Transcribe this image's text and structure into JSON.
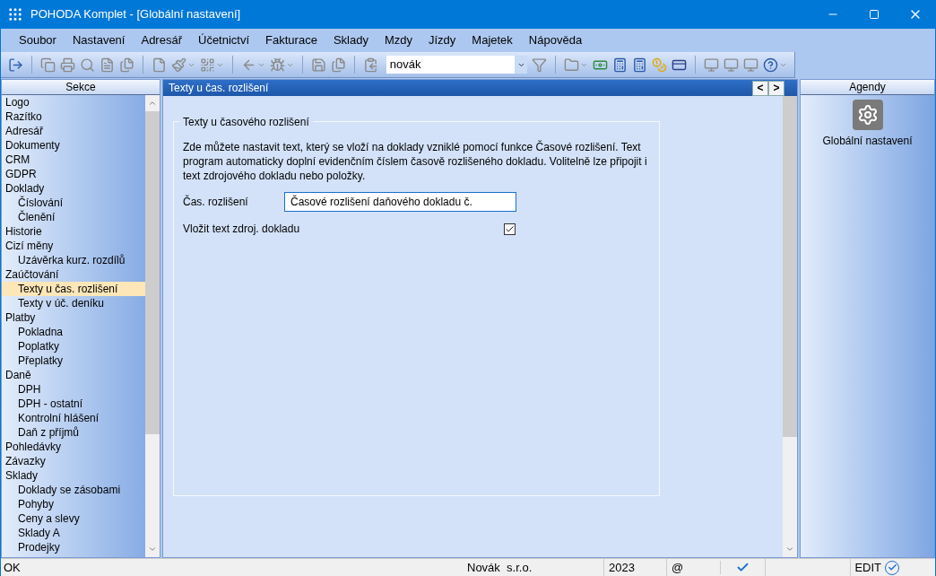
{
  "window": {
    "title": "POHODA Komplet - [Globální nastavení]"
  },
  "menu": [
    "Soubor",
    "Nastavení",
    "Adresář",
    "Účetnictví",
    "Fakturace",
    "Sklady",
    "Mzdy",
    "Jízdy",
    "Majetek",
    "Nápověda"
  ],
  "toolbar": {
    "company_combo": {
      "value": "novák"
    }
  },
  "sections": {
    "title": "Sekce",
    "items": [
      {
        "label": "Logo",
        "selected": false
      },
      {
        "label": "Razítko",
        "selected": false
      },
      {
        "label": "Adresář",
        "selected": false
      },
      {
        "label": "Dokumenty",
        "selected": false
      },
      {
        "label": "CRM",
        "selected": false
      },
      {
        "label": "GDPR",
        "selected": false
      },
      {
        "label": "Doklady",
        "selected": false,
        "children": [
          {
            "label": "Číslování",
            "selected": false
          },
          {
            "label": "Členění",
            "selected": false
          }
        ]
      },
      {
        "label": "Historie",
        "selected": false
      },
      {
        "label": "Cizí měny",
        "selected": false,
        "children": [
          {
            "label": "Uzávěrka kurz. rozdílů",
            "selected": false
          }
        ]
      },
      {
        "label": "Zaúčtování",
        "selected": false,
        "children": [
          {
            "label": "Texty u čas. rozlišení",
            "selected": true
          },
          {
            "label": "Texty v úč. deníku",
            "selected": false
          }
        ]
      },
      {
        "label": "Platby",
        "selected": false,
        "children": [
          {
            "label": "Pokladna",
            "selected": false
          },
          {
            "label": "Poplatky",
            "selected": false
          },
          {
            "label": "Přeplatky",
            "selected": false
          }
        ]
      },
      {
        "label": "Daně",
        "selected": false,
        "children": [
          {
            "label": "DPH",
            "selected": false
          },
          {
            "label": "DPH - ostatní",
            "selected": false
          },
          {
            "label": "Kontrolní hlášení",
            "selected": false
          },
          {
            "label": "Daň z příjmů",
            "selected": false
          }
        ]
      },
      {
        "label": "Pohledávky",
        "selected": false
      },
      {
        "label": "Závazky",
        "selected": false
      },
      {
        "label": "Sklady",
        "selected": false,
        "children": [
          {
            "label": "Doklady se zásobami",
            "selected": false
          },
          {
            "label": "Pohyby",
            "selected": false
          },
          {
            "label": "Ceny a slevy",
            "selected": false
          },
          {
            "label": "Sklady A",
            "selected": false
          },
          {
            "label": "Prodejky",
            "selected": false
          }
        ]
      }
    ]
  },
  "content": {
    "title": "Texty u čas. rozlišení",
    "nav": [
      "<",
      ">"
    ],
    "group": {
      "legend": "Texty u časového rozlišení",
      "description": "Zde můžete nastavit text, který se vloží na doklady vzniklé pomocí funkce Časové rozlišení. Text program automaticky doplní evidenčním číslem časově rozlišeného dokladu. Volitelně lze připojit i text zdrojového dokladu nebo položky.",
      "fields": [
        {
          "kind": "text",
          "label": "Čas. rozlišení",
          "value": "Časové rozlišení daňového dokladu č."
        },
        {
          "kind": "checkbox",
          "label": "Vložit text zdroj. dokladu",
          "checked": true
        }
      ]
    }
  },
  "agendas": {
    "title": "Agendy",
    "items": [
      {
        "label": "Globální nastavení"
      }
    ]
  },
  "status_bar": {
    "message": "OK",
    "company": "Novák  s.r.o.",
    "year": "2023",
    "email": "@",
    "mode": "EDIT"
  }
}
